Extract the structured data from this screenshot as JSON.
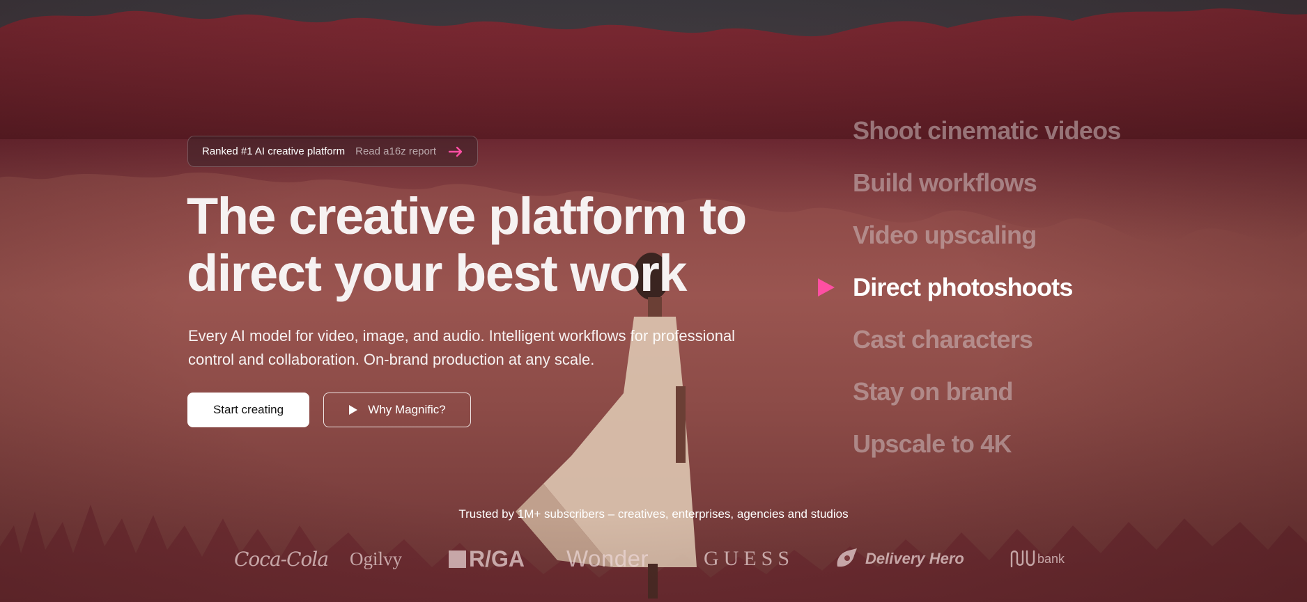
{
  "badge": {
    "main_text": "Ranked #1 AI creative platform",
    "link_text": "Read a16z report",
    "arrow_icon": "arrow-right-icon",
    "accent_color": "#ff4fa3"
  },
  "hero": {
    "headline_line1": "The creative platform to",
    "headline_line2": "direct your best work",
    "subtitle_line1": "Every AI model for video, image, and audio. Intelligent workflows for professional",
    "subtitle_line2": "control and collaboration. On-brand production at any scale.",
    "primary_button": "Start creating",
    "secondary_button": "Why Magnific?",
    "secondary_icon": "play-icon"
  },
  "features": {
    "items": [
      {
        "label": "Shoot cinematic videos",
        "active": false
      },
      {
        "label": "Build workflows",
        "active": false
      },
      {
        "label": "Video upscaling",
        "active": false
      },
      {
        "label": "Direct photoshoots",
        "active": true
      },
      {
        "label": "Cast characters",
        "active": false
      },
      {
        "label": "Stay on brand",
        "active": false
      },
      {
        "label": "Upscale to 4K",
        "active": false
      }
    ],
    "active_marker_icon": "play-triangle-icon",
    "active_marker_color": "#ff4fa3"
  },
  "trusted": {
    "text": "Trusted by 1M+ subscribers – creatives, enterprises, agencies and studios"
  },
  "logos": {
    "cocacola": "Coca-Cola",
    "ogilvy": "Ogilvy",
    "rga": "R/GA",
    "wonder": "Wonder",
    "guess": "GUESS",
    "deliveryhero": "Delivery Hero",
    "nubank": "bank"
  }
}
